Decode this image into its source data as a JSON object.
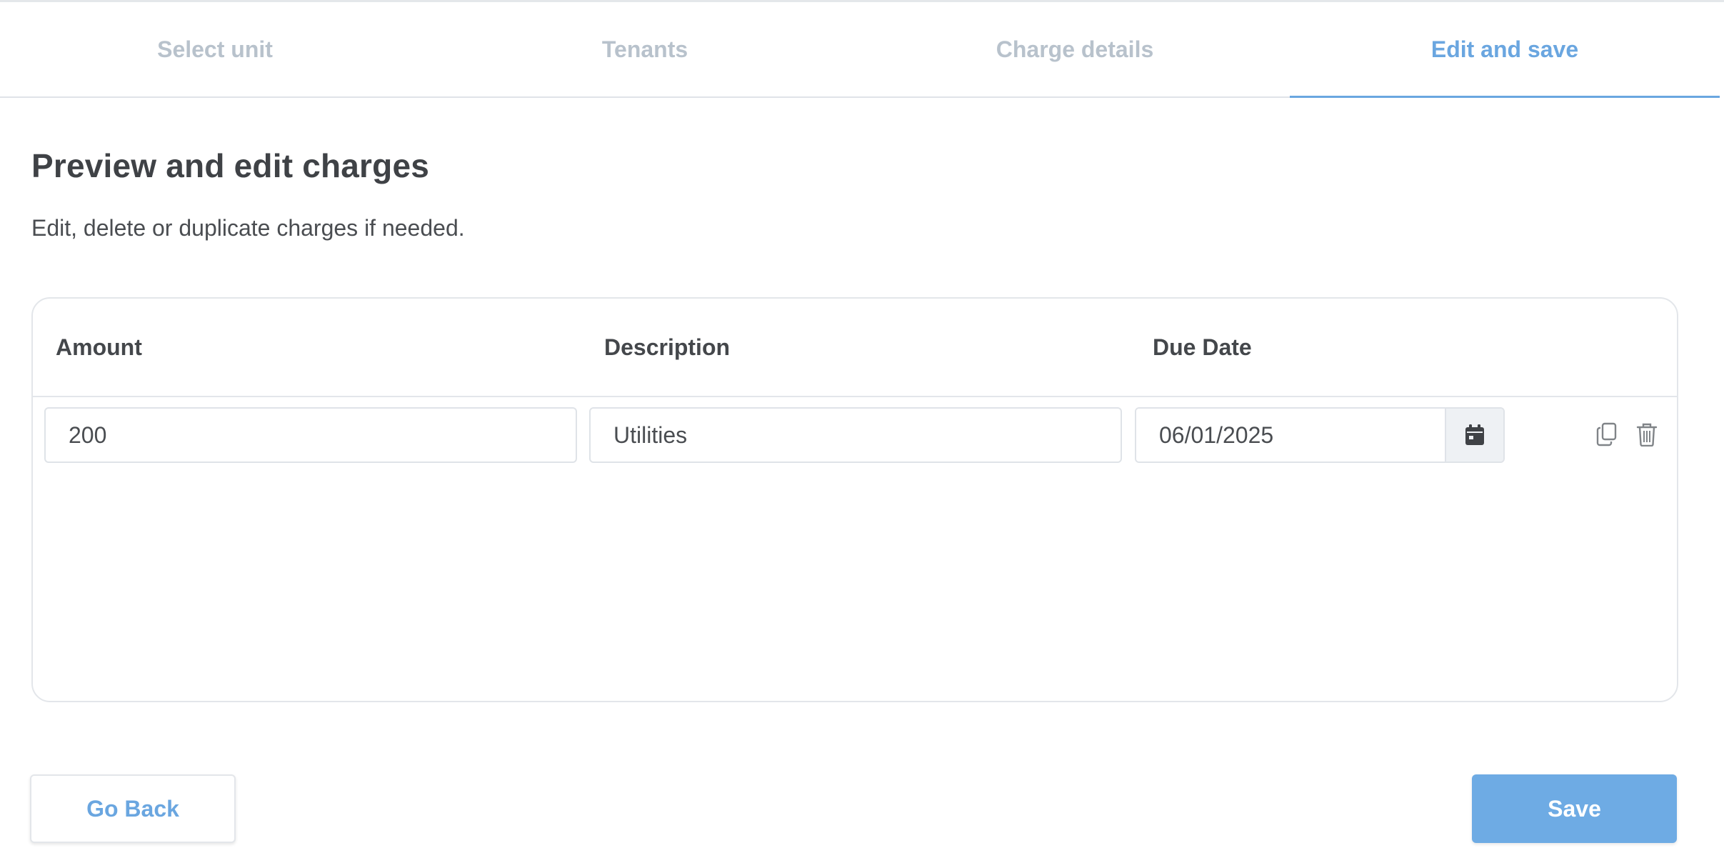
{
  "stepper": {
    "steps": [
      {
        "label": "Select unit",
        "state": "inactive"
      },
      {
        "label": "Tenants",
        "state": "inactive"
      },
      {
        "label": "Charge details",
        "state": "inactive"
      },
      {
        "label": "Edit and save",
        "state": "active"
      }
    ]
  },
  "main": {
    "title": "Preview and edit charges",
    "subtitle": "Edit, delete or duplicate charges if needed."
  },
  "charges_table": {
    "columns": {
      "amount": "Amount",
      "description": "Description",
      "due_date": "Due Date"
    },
    "rows": [
      {
        "amount": "200",
        "description": "Utilities",
        "due_date": "06/01/2025",
        "icons": [
          "calendar-icon",
          "duplicate-icon",
          "trash-icon"
        ]
      }
    ]
  },
  "footer": {
    "back_label": "Go Back",
    "save_label": "Save"
  },
  "colors": {
    "accent": "#6aa6e0",
    "save_button": "#6eabe4",
    "inactive_step": "#b8c2cc",
    "border": "#e3e6ea"
  }
}
